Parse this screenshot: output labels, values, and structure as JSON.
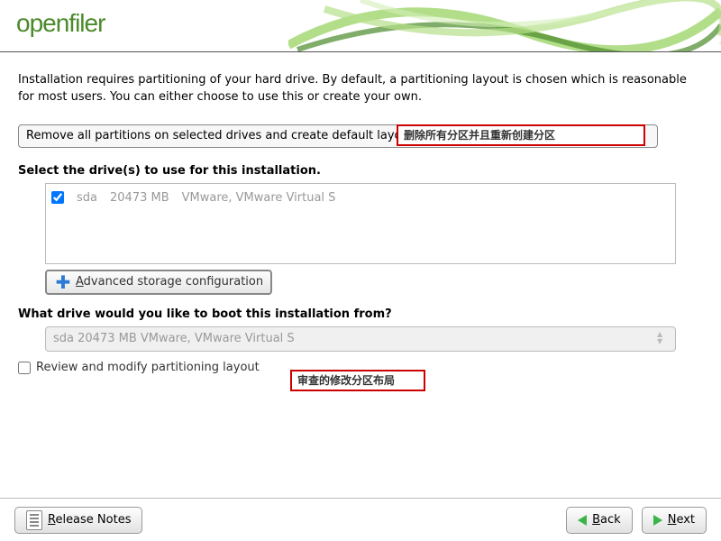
{
  "header": {
    "logo_text": "openfiler"
  },
  "intro": "Installation requires partitioning of your hard drive.  By default, a partitioning layout is chosen which is reasonable for most users.  You can either choose to use this or create your own.",
  "layout_select": {
    "text": "Remove all partitions on selected drives and create default layout",
    "annotation": "删除所有分区并且重新创建分区"
  },
  "drives": {
    "label": "Select the drive(s) to use for this installation.",
    "items": [
      {
        "name": "sda",
        "size": "20473 MB",
        "desc": "VMware, VMware Virtual S",
        "checked": true
      }
    ]
  },
  "advanced_btn": {
    "text_u": "A",
    "text_rest": "dvanced storage configuration"
  },
  "boot": {
    "label": "What drive would you like to boot this installation from?",
    "value": "sda     20473 MB VMware, VMware Virtual S"
  },
  "review": {
    "label": "Review and modify partitioning layout",
    "checked": false,
    "annotation": "审查的修改分区布局"
  },
  "footer": {
    "release_u": "R",
    "release_rest": "elease Notes",
    "back_u": "B",
    "back_rest": "ack",
    "next_u": "N",
    "next_rest": "ext"
  }
}
